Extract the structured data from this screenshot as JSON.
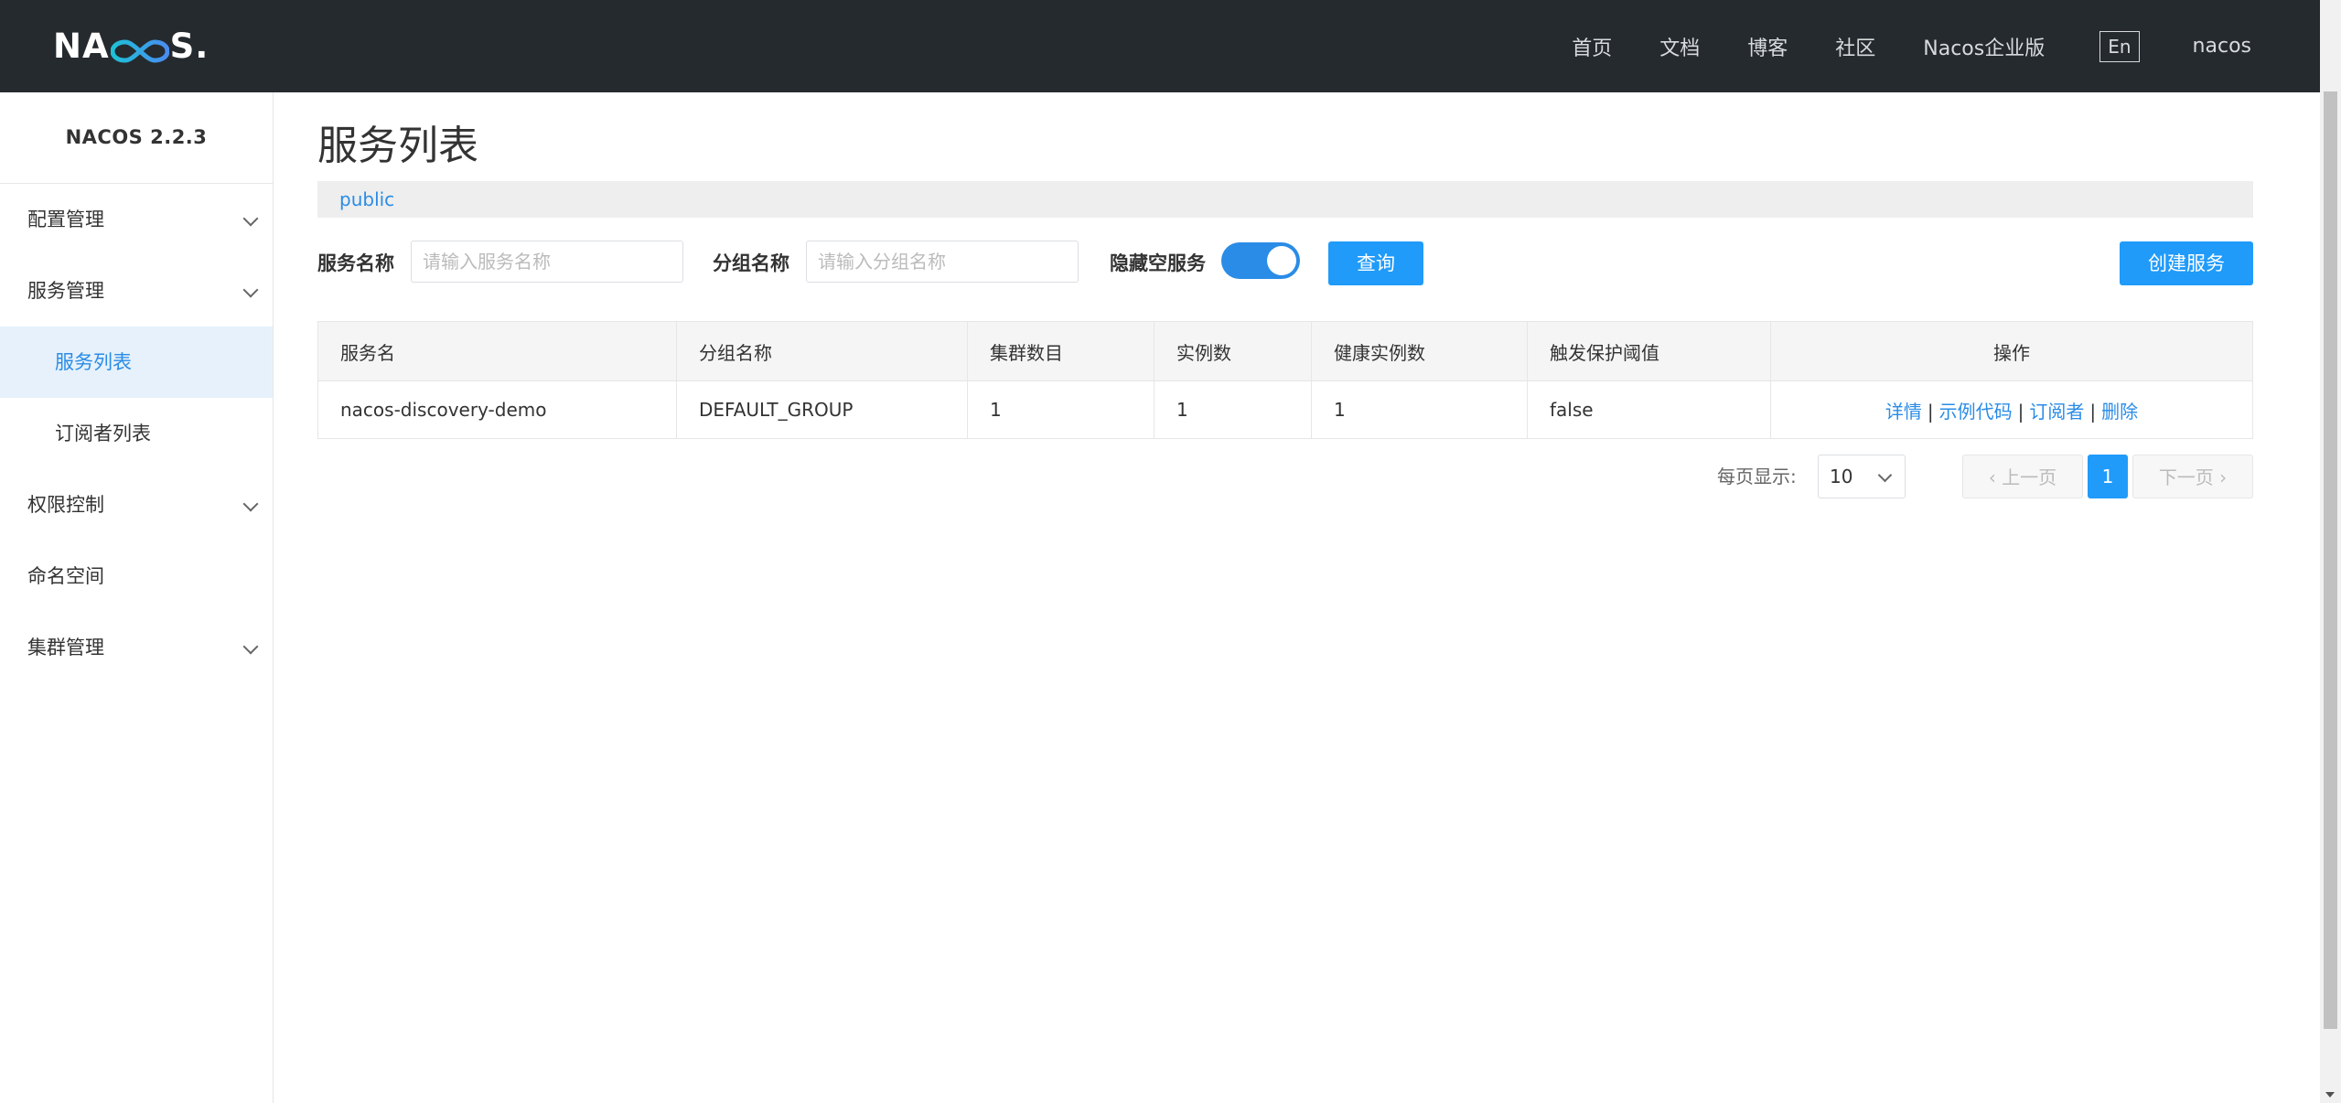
{
  "brand": {
    "logo_text": "NACOS"
  },
  "nav": {
    "items": [
      "首页",
      "文档",
      "博客",
      "社区",
      "Nacos企业版"
    ],
    "lang": "En",
    "user": "nacos"
  },
  "sidebar": {
    "version": "NACOS 2.2.3",
    "items": [
      {
        "label": "配置管理"
      },
      {
        "label": "服务管理"
      },
      {
        "label": "服务列表"
      },
      {
        "label": "订阅者列表"
      },
      {
        "label": "权限控制"
      },
      {
        "label": "命名空间"
      },
      {
        "label": "集群管理"
      }
    ]
  },
  "page": {
    "title": "服务列表",
    "namespace": "public"
  },
  "filters": {
    "service_label": "服务名称",
    "service_placeholder": "请输入服务名称",
    "group_label": "分组名称",
    "group_placeholder": "请输入分组名称",
    "hide_empty_label": "隐藏空服务",
    "hide_empty_on": true,
    "query_button": "查询",
    "create_button": "创建服务"
  },
  "table": {
    "columns": [
      "服务名",
      "分组名称",
      "集群数目",
      "实例数",
      "健康实例数",
      "触发保护阈值",
      "操作"
    ],
    "rows": [
      {
        "service": "nacos-discovery-demo",
        "group": "DEFAULT_GROUP",
        "clusters": "1",
        "instances": "1",
        "healthy": "1",
        "threshold": "false",
        "ops": [
          "详情",
          "示例代码",
          "订阅者",
          "删除"
        ]
      }
    ]
  },
  "pagination": {
    "page_size_label": "每页显示:",
    "page_size": "10",
    "prev": "上一页",
    "current": "1",
    "next": "下一页"
  },
  "colors": {
    "topbar": "#252a2f",
    "primary": "#209bfa",
    "link": "#2a8ce6",
    "active_menu_bg": "#e6f1fb"
  }
}
